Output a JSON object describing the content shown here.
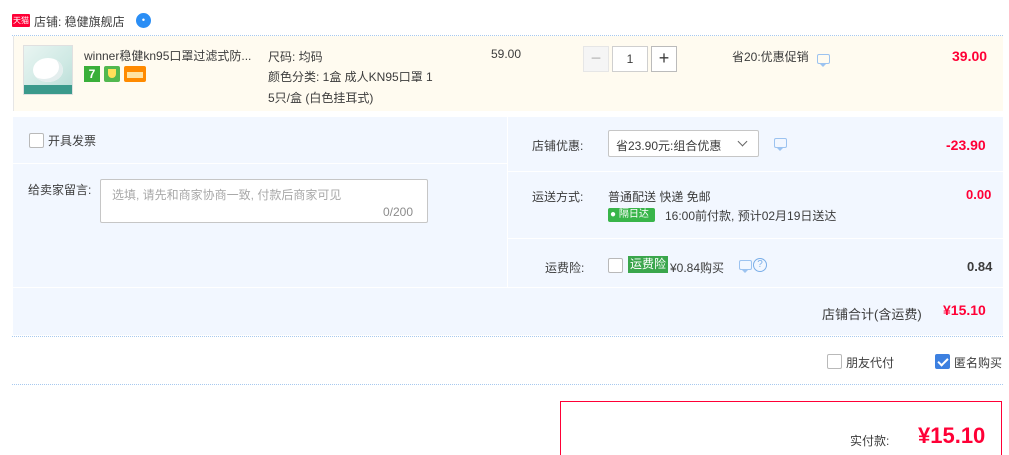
{
  "shop": {
    "badge": "天猫",
    "title": "店铺: 稳健旗舰店",
    "chat_icon": "chat-bubble-icon"
  },
  "item": {
    "name": "winner稳健kn95口罩过滤式防...",
    "spec_size": "尺码: 均码",
    "spec_color_line1": "颜色分类: 1盒 成人KN95口罩 1",
    "spec_color_line2": "5只/盒 (白色挂耳式)",
    "tag_seven": "7",
    "price": "59.00",
    "quantity": "1",
    "minus": "−",
    "plus": "+",
    "promo": "省20:优惠促销",
    "total": "39.00"
  },
  "invoice": {
    "label": "开具发票",
    "checked": false
  },
  "message": {
    "label": "给卖家留言:",
    "placeholder": "选填, 请先和商家协商一致, 付款后商家可见",
    "count": "0/200"
  },
  "discount": {
    "label": "店铺优惠:",
    "selected": "省23.90元:组合优惠",
    "amount": "-23.90"
  },
  "shipping": {
    "label": "运送方式:",
    "method": "普通配送 快递 免邮",
    "badge": "隔日达",
    "note": "16:00前付款, 预计02月19日送达",
    "amount": "0.00"
  },
  "insurance": {
    "label": "运费险:",
    "tag": "运费险",
    "text": "¥0.84购买",
    "help": "?",
    "amount": "0.84",
    "checked": false
  },
  "summary": {
    "label": "店铺合计(含运费)",
    "amount": "¥15.10"
  },
  "options": {
    "friend_pay": "朋友代付",
    "friend_checked": false,
    "anonymous": "匿名购买",
    "anonymous_checked": true
  },
  "payment": {
    "label": "实付款:",
    "amount": "¥15.10"
  },
  "colors": {
    "accent": "#ff0036",
    "panel": "#f2f7ff",
    "check": "#3d80e0"
  }
}
